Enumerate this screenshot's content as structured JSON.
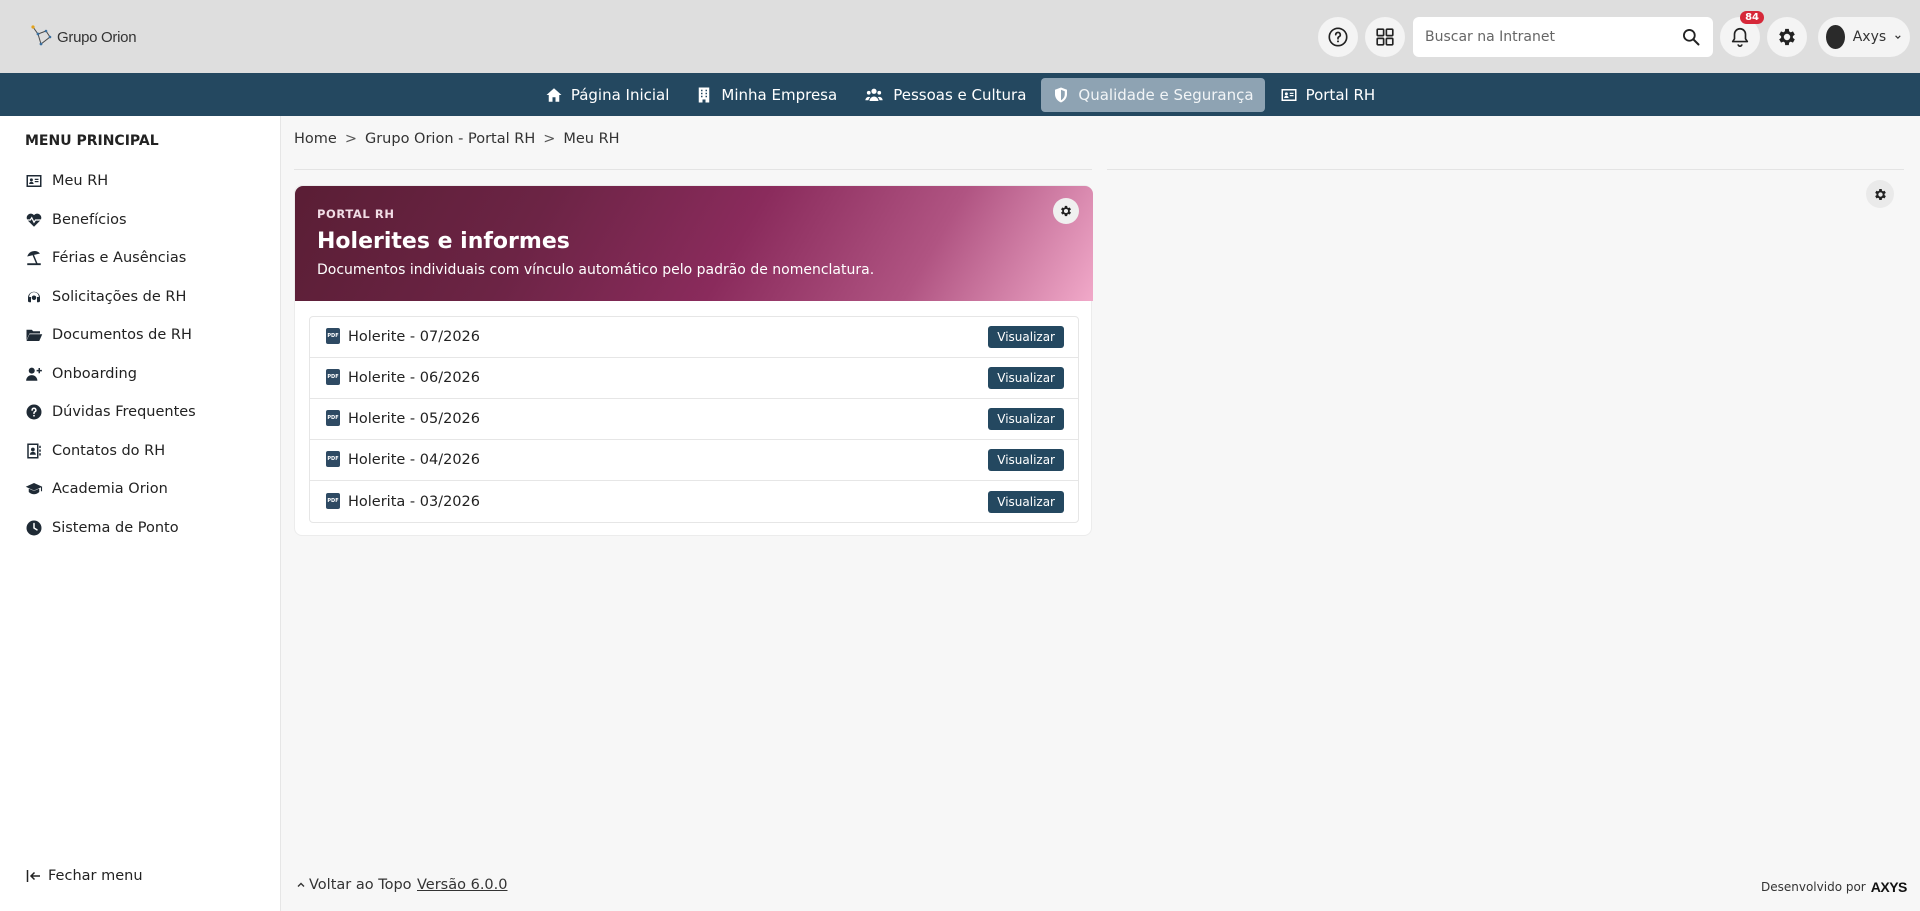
{
  "header": {
    "logo_text": "Grupo Orion",
    "search_placeholder": "Buscar na Intranet",
    "notifications_count": "84",
    "user_name": "Axys"
  },
  "nav": {
    "items": [
      {
        "label": "Página Inicial",
        "icon": "home-icon"
      },
      {
        "label": "Minha Empresa",
        "icon": "building-icon"
      },
      {
        "label": "Pessoas e Cultura",
        "icon": "users-icon"
      },
      {
        "label": "Qualidade e Segurança",
        "icon": "shield-icon",
        "active": true
      },
      {
        "label": "Portal RH",
        "icon": "id-card-icon"
      }
    ]
  },
  "sidebar": {
    "title": "MENU PRINCIPAL",
    "items": [
      {
        "label": "Meu RH",
        "icon": "id-card-icon"
      },
      {
        "label": "Benefícios",
        "icon": "heart-pulse-icon"
      },
      {
        "label": "Férias e Ausências",
        "icon": "umbrella-beach-icon"
      },
      {
        "label": "Solicitações de RH",
        "icon": "headset-icon"
      },
      {
        "label": "Documentos de RH",
        "icon": "folder-open-icon"
      },
      {
        "label": "Onboarding",
        "icon": "user-plus-icon"
      },
      {
        "label": "Dúvidas Frequentes",
        "icon": "question-circle-icon"
      },
      {
        "label": "Contatos do RH",
        "icon": "address-book-icon"
      },
      {
        "label": "Academia Orion",
        "icon": "graduation-cap-icon"
      },
      {
        "label": "Sistema de Ponto",
        "icon": "clock-icon"
      }
    ],
    "close_label": "Fechar menu"
  },
  "breadcrumb": {
    "items": [
      "Home",
      "Grupo Orion - Portal RH",
      "Meu RH"
    ],
    "separator": ">"
  },
  "card": {
    "eyebrow": "PORTAL RH",
    "title": "Holerites e informes",
    "subtitle": "Documentos individuais com vínculo automático pelo padrão de nomenclatura.",
    "view_label": "Visualizar",
    "pdf_label": "PDF",
    "documents": [
      "Holerite - 07/2026",
      "Holerite - 06/2026",
      "Holerite - 05/2026",
      "Holerite - 04/2026",
      "Holerita - 03/2026"
    ]
  },
  "footer": {
    "back_to_top": "Voltar ao Topo",
    "version": "Versão 6.0.0",
    "developed_by": "Desenvolvido por",
    "brand": "AXYS"
  },
  "colors": {
    "nav_bg": "#244860",
    "button_bg": "#244860",
    "badge": "#d62839",
    "banner_start": "#5a1e35",
    "banner_end": "#f1a9c9"
  }
}
